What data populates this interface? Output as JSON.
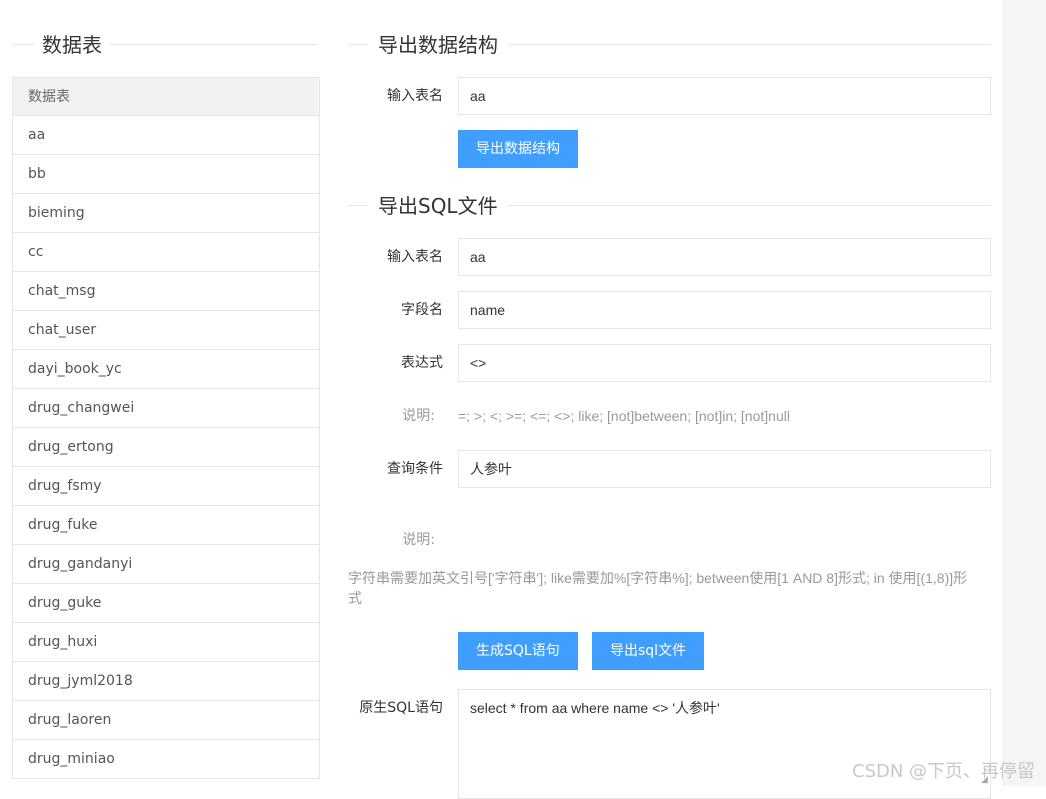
{
  "left_panel": {
    "legend": "数据表",
    "header": "数据表",
    "rows": [
      "aa",
      "bb",
      "bieming",
      "cc",
      "chat_msg",
      "chat_user",
      "dayi_book_yc",
      "drug_changwei",
      "drug_ertong",
      "drug_fsmy",
      "drug_fuke",
      "drug_gandanyi",
      "drug_guke",
      "drug_huxi",
      "drug_jyml2018",
      "drug_laoren",
      "drug_miniao"
    ]
  },
  "export_structure": {
    "legend": "导出数据结构",
    "table_label": "输入表名",
    "table_value": "aa",
    "button": "导出数据结构"
  },
  "export_sql": {
    "legend": "导出SQL文件",
    "table_label": "输入表名",
    "table_value": "aa",
    "field_label": "字段名",
    "field_value": "name",
    "expr_label": "表达式",
    "expr_value": "<>",
    "expr_note_label": "说明:",
    "expr_note": "=; >; <; >=; <=; <>; like; [not]between; [not]in; [not]null",
    "condition_label": "查询条件",
    "condition_value": "人参叶",
    "condition_note_label": "说明:",
    "condition_note": "字符串需要加英文引号['字符串']; like需要加%[字符串%]; between使用[1 AND 8]形式; in 使用[(1,8)]形式",
    "gen_button": "生成SQL语句",
    "export_button": "导出sql文件",
    "raw_label": "原生SQL语句",
    "raw_value": "select * from aa where name <> '人参叶'"
  },
  "watermark": "CSDN @下页、再停留",
  "colors": {
    "primary": "#409eff",
    "border": "#e6e6e6",
    "header_bg": "#f2f2f2",
    "muted_text": "#999999"
  }
}
